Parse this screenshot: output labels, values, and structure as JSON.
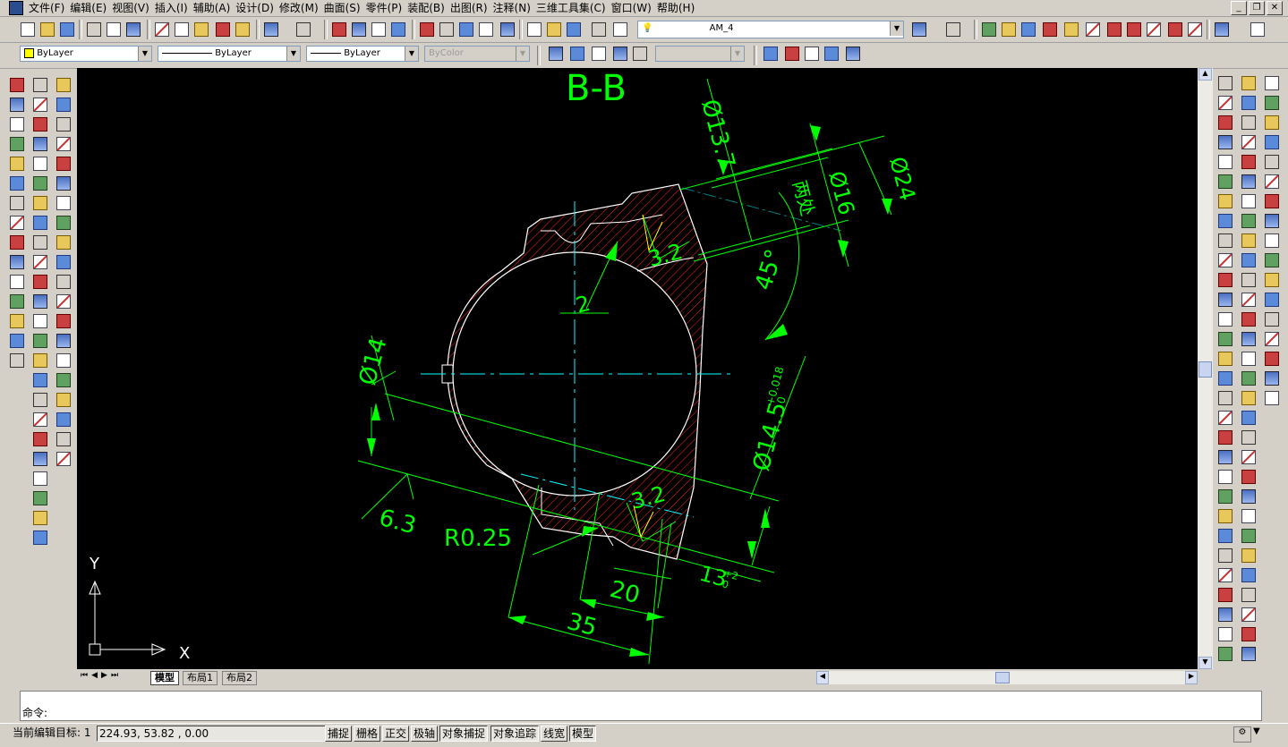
{
  "menu": [
    "文件(F)",
    "编辑(E)",
    "视图(V)",
    "插入(I)",
    "辅助(A)",
    "设计(D)",
    "修改(M)",
    "曲面(S)",
    "零件(P)",
    "装配(B)",
    "出图(R)",
    "注释(N)",
    "三维工具集(C)",
    "窗口(W)",
    "帮助(H)"
  ],
  "layer_combo": "AM_4",
  "properties": {
    "color": "ByLayer",
    "linetype": "ByLayer",
    "lineweight": "ByLayer",
    "plotstyle": "ByColor"
  },
  "drawing": {
    "section_title": "B-B",
    "dims": {
      "d13_7": "Ø13.7",
      "d16": "Ø16",
      "d24": "Ø24",
      "two_places": "两处",
      "angle45": "45°",
      "rough1": "3.2",
      "rough2": "3.2",
      "two": "2",
      "d14": "Ø14",
      "d14_5": "Ø14.5",
      "d14_5_tol_upper": "+0.018",
      "d14_5_tol_lower": "0",
      "rough_6_3": "6.3",
      "r0_25": "R0.25",
      "dim13": "13",
      "dim13_tol_upper": "+2",
      "dim13_tol_lower": "0",
      "dim20": "20",
      "dim35": "35"
    },
    "ucs_x": "X",
    "ucs_y": "Y"
  },
  "tabs": [
    "模型",
    "布局1",
    "布局2"
  ],
  "command_prompt": "命令:",
  "status": {
    "target_label": "当前编辑目标: 1",
    "coords": "224.93, 53.82 , 0.00",
    "buttons": [
      "捕捉",
      "栅格",
      "正交",
      "极轴",
      "对象捕捉",
      "对象追踪",
      "线宽",
      "模型"
    ]
  },
  "colors": {
    "canvas": "#000000",
    "dim": "#00ff00",
    "hatch": "#ff0000",
    "center": "#00ffff",
    "geometry": "#ffffff",
    "rough": "#ffff00"
  }
}
